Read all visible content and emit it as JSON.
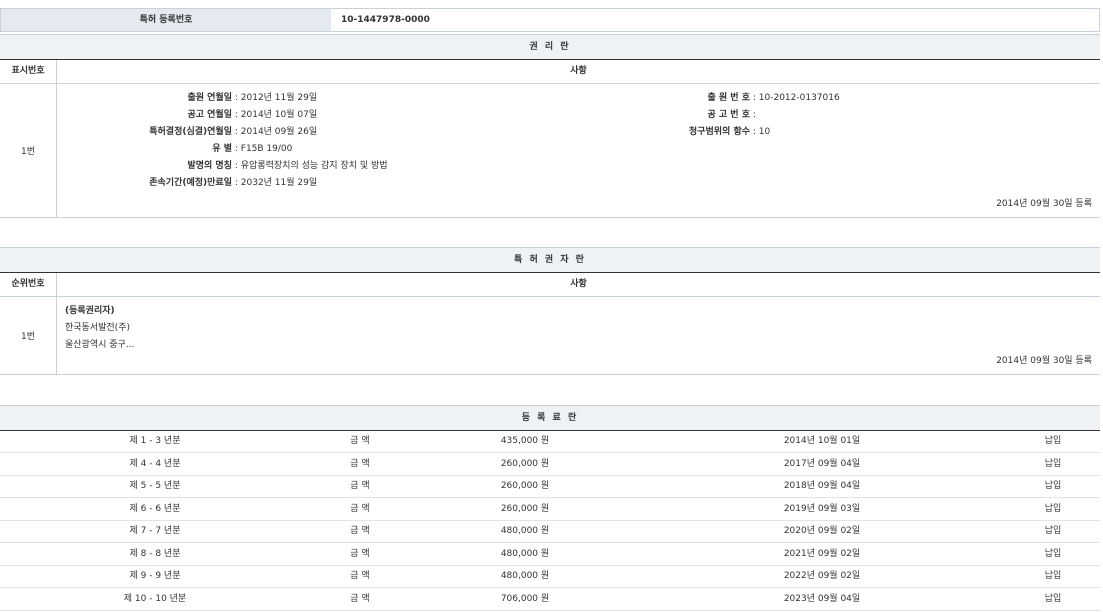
{
  "registration": {
    "label": "특허 등록번호",
    "value": "10-1447978-0000"
  },
  "rights": {
    "bar_title": "권 리 란",
    "col_no": "표시번호",
    "col_content": "사항",
    "row_no": "1번",
    "left_fields": [
      {
        "key": "출원 연월일",
        "value": "2012년 11월 29일"
      },
      {
        "key": "공고 연월일",
        "value": "2014년 10월 07일"
      },
      {
        "key": "특허결정(심결)연월일",
        "value": "2014년 09월 26일"
      },
      {
        "key": "유 별",
        "value": "F15B 19/00"
      },
      {
        "key": "발명의 명칭",
        "value": "유압롱력장치의 성능 감지 장치 및 방법"
      },
      {
        "key": "존속기간(예정)만료일",
        "value": "2032년 11월 29일"
      }
    ],
    "right_fields": [
      {
        "key": "출 원 번 호",
        "value": "10-2012-0137016"
      },
      {
        "key": "공 고 번 호",
        "value": ""
      },
      {
        "key": "청구범위의 항수",
        "value": "10"
      }
    ],
    "registered_date": "2014년 09월 30일 등록"
  },
  "holders": {
    "bar_title": "특 허 권 자 란",
    "col_no": "순위번호",
    "col_content": "사항",
    "row_no": "1번",
    "label": "(등록권리자)",
    "name": "한국동서발전(주)",
    "address": "울산광역시 중구...",
    "registered_date": "2014년 09월 30일 등록"
  },
  "fees": {
    "bar_title": "등 록 료 란",
    "rows": [
      {
        "period": "제 1 - 3 년분",
        "label": "금 액",
        "amount": "435,000 원",
        "date": "2014년 10월 01일",
        "status": "납입"
      },
      {
        "period": "제 4 - 4 년분",
        "label": "금 액",
        "amount": "260,000 원",
        "date": "2017년 09월 04일",
        "status": "납입"
      },
      {
        "period": "제 5 - 5 년분",
        "label": "금 액",
        "amount": "260,000 원",
        "date": "2018년 09월 04일",
        "status": "납입"
      },
      {
        "period": "제 6 - 6 년분",
        "label": "금 액",
        "amount": "260,000 원",
        "date": "2019년 09월 03일",
        "status": "납입"
      },
      {
        "period": "제 7 - 7 년분",
        "label": "금 액",
        "amount": "480,000 원",
        "date": "2020년 09월 02일",
        "status": "납입"
      },
      {
        "period": "제 8 - 8 년분",
        "label": "금 액",
        "amount": "480,000 원",
        "date": "2021년 09월 02일",
        "status": "납입"
      },
      {
        "period": "제 9 - 9 년분",
        "label": "금 액",
        "amount": "480,000 원",
        "date": "2022년 09월 02일",
        "status": "납입"
      },
      {
        "period": "제 10 - 10 년분",
        "label": "금 액",
        "amount": "706,000 원",
        "date": "2023년 09월 04일",
        "status": "납입"
      }
    ]
  }
}
